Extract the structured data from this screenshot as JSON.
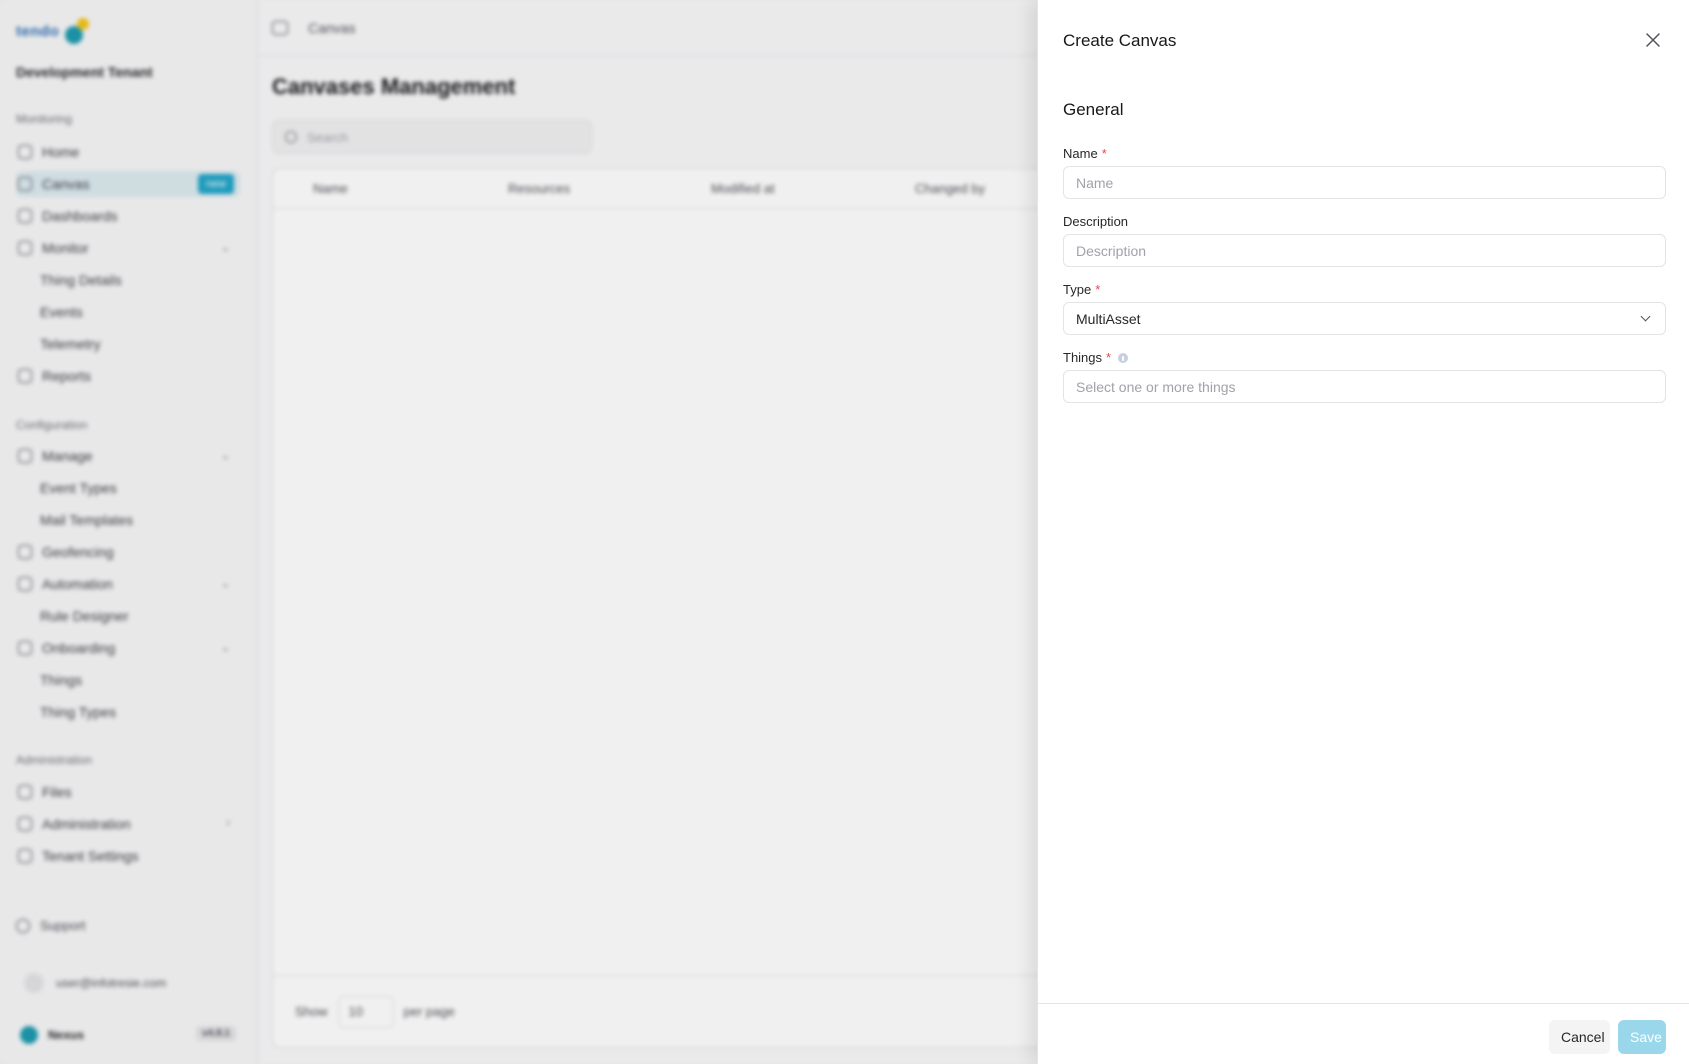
{
  "background": {
    "logo_text": "tendo",
    "tenant": "Development Tenant",
    "sections": {
      "monitoring": "Monitoring",
      "configuration": "Configuration",
      "administration": "Administration"
    },
    "nav": [
      {
        "label": "Home",
        "icon": "home-icon"
      },
      {
        "label": "Canvas",
        "icon": "canvas-icon",
        "badge": "new"
      },
      {
        "label": "Dashboards",
        "icon": "dashboard-icon"
      },
      {
        "label": "Monitor",
        "icon": "monitor-icon"
      },
      {
        "label": "Thing Details",
        "icon": ""
      },
      {
        "label": "Events",
        "icon": ""
      },
      {
        "label": "Telemetry",
        "icon": ""
      },
      {
        "label": "Reports",
        "icon": "reports-icon"
      },
      {
        "label": "Manage",
        "icon": "manage-icon"
      },
      {
        "label": "Event Types",
        "icon": ""
      },
      {
        "label": "Mail Templates",
        "icon": ""
      },
      {
        "label": "Geofencing",
        "icon": "geofence-icon"
      },
      {
        "label": "Automation",
        "icon": "automation-icon"
      },
      {
        "label": "Rule Designer",
        "icon": ""
      },
      {
        "label": "Onboarding",
        "icon": "onboarding-icon"
      },
      {
        "label": "Things",
        "icon": ""
      },
      {
        "label": "Thing Types",
        "icon": ""
      },
      {
        "label": "Files",
        "icon": "files-icon"
      },
      {
        "label": "Administration",
        "icon": "admin-icon"
      },
      {
        "label": "Tenant Settings",
        "icon": "settings-icon"
      }
    ],
    "support": "Support",
    "user_email": "user@infotresie.com",
    "brand_name": "Nexus",
    "version": "v4.8.1",
    "breadcrumb": "Canvas",
    "page_title": "Canvases Management",
    "search_placeholder": "Search",
    "columns": [
      "Name",
      "Resources",
      "Modified at",
      "Changed by"
    ],
    "footer": {
      "show": "Show",
      "per_page_value": "10",
      "per_page": "per page"
    }
  },
  "dialog": {
    "title": "Create Canvas",
    "section_title": "General",
    "fields": {
      "name": {
        "label": "Name",
        "placeholder": "Name",
        "required": "*"
      },
      "description": {
        "label": "Description",
        "placeholder": "Description"
      },
      "type": {
        "label": "Type",
        "value": "MultiAsset",
        "required": "*"
      },
      "things": {
        "label": "Things",
        "placeholder": "Select one or more things",
        "required": "*"
      }
    },
    "cancel_label": "Cancel",
    "save_label": "Save",
    "colors": {
      "required": "#e5484d",
      "save_disabled": "#9ad7ea",
      "badge": "#22a5c9"
    }
  }
}
